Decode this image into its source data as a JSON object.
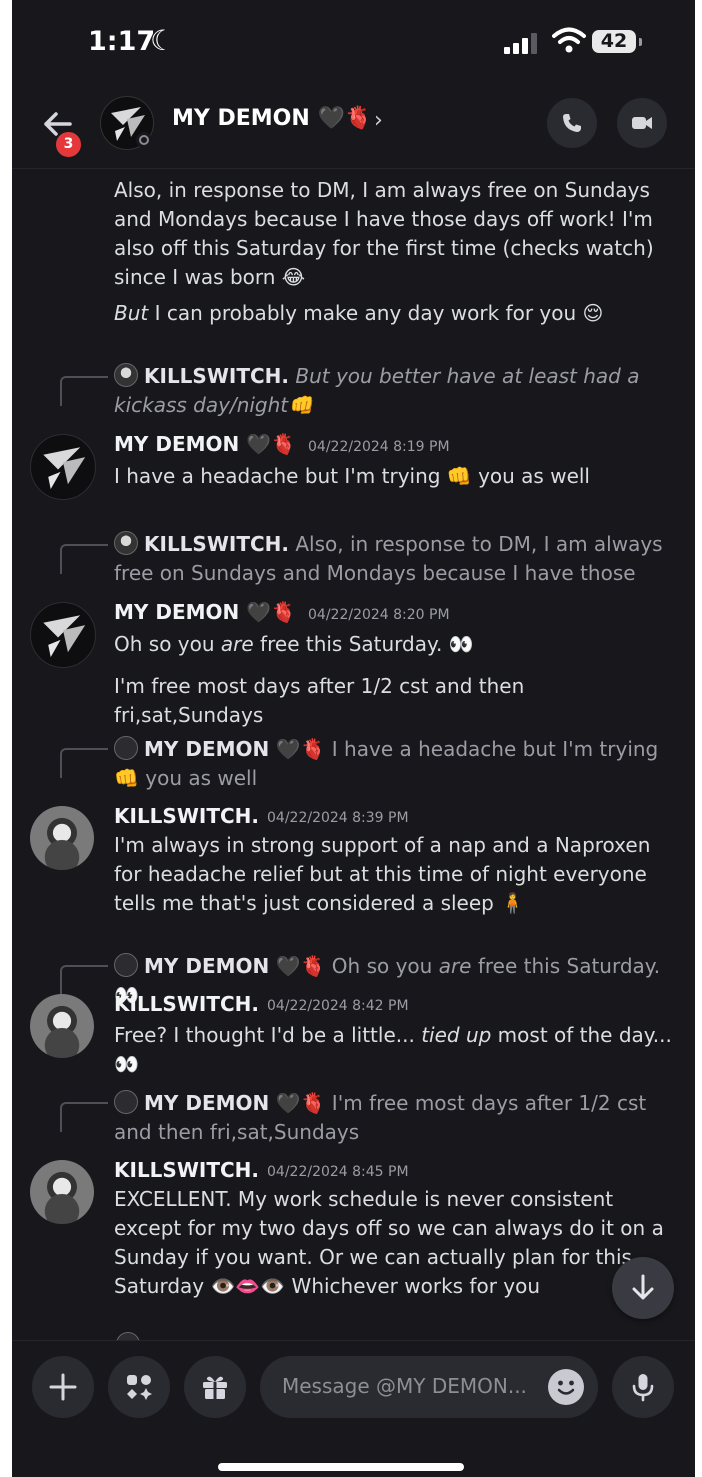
{
  "status_bar": {
    "time": "1:17",
    "battery": "42"
  },
  "header": {
    "unread_badge": "3",
    "contact_name": "MY DEMON",
    "name_emoji": "🖤🫀",
    "chevron": "›"
  },
  "messages": {
    "cont_1": "Also, in response to DM, I am always free on Sundays and Mondays because I have those days off work! I'm also off this Saturday for the first time (checks watch) since I was born 😂",
    "cont_2_em": "But",
    "cont_2_rest": " I can probably make any day work for you 😌",
    "r1_name": "KILLSWITCH.",
    "r1_text": "But you better have at least had a kickass day/night👊",
    "m1_name": "MY DEMON",
    "m1_emoji": "🖤🫀",
    "m1_time": "04/22/2024 8:19 PM",
    "m1_text": "I have a headache but I'm trying 👊 you as well",
    "r2_name": "KILLSWITCH.",
    "r2_text": "Also, in response to DM, I am always free on Sundays and Mondays because I have those days off ...",
    "m2_name": "MY DEMON",
    "m2_emoji": "🖤🫀",
    "m2_time": "04/22/2024 8:20 PM",
    "m2_text_a": "Oh so you ",
    "m2_text_em": "are",
    "m2_text_b": " free this Saturday. 👀",
    "m2_text_2": "I'm free most days after 1/2 cst and then fri,sat,Sundays",
    "r3_name": "MY DEMON",
    "r3_emoji": "🖤🫀",
    "r3_text": "I have a headache but I'm trying 👊 you as well",
    "m3_name": "KILLSWITCH.",
    "m3_time": "04/22/2024 8:39 PM",
    "m3_text": "I'm always in strong support of a nap and a Naproxen for headache relief but at this time of night everyone tells me that's just considered a sleep 🧍",
    "r4_name": "MY DEMON",
    "r4_emoji": "🖤🫀",
    "r4_text_a": "Oh so you ",
    "r4_text_em": "are",
    "r4_text_b": " free this Saturday. 👀",
    "m4_name": "KILLSWITCH.",
    "m4_time": "04/22/2024 8:42 PM",
    "m4_text_a": "Free? I thought I'd be a little... ",
    "m4_text_em": "tied up",
    "m4_text_b": " most of the day... 👀",
    "r5_name": "MY DEMON",
    "r5_emoji": "🖤🫀",
    "r5_text": "I'm free most days after 1/2 cst and then fri,sat,Sundays",
    "m5_name": "KILLSWITCH.",
    "m5_time": "04/22/2024 8:45 PM",
    "m5_text": "EXCELLENT. My work schedule is never consistent except for my two days off so we can always do it on a Sunday if you want. Or we can actually plan for this Saturday 👁️👄👁️ Whichever works for you"
  },
  "composer": {
    "placeholder": "Message @MY DEMON..."
  },
  "icons": {
    "back": "arrow-left-icon",
    "call": "phone-icon",
    "video": "video-camera-icon",
    "add": "plus-icon",
    "apps": "apps-icon",
    "gift": "gift-icon",
    "emoji": "emoji-icon",
    "mic": "microphone-icon",
    "scroll": "arrow-down-icon"
  },
  "colors": {
    "background": "#18181c",
    "text": "#dbdee1",
    "muted": "#9b9ca4",
    "badge": "#e5383b"
  }
}
